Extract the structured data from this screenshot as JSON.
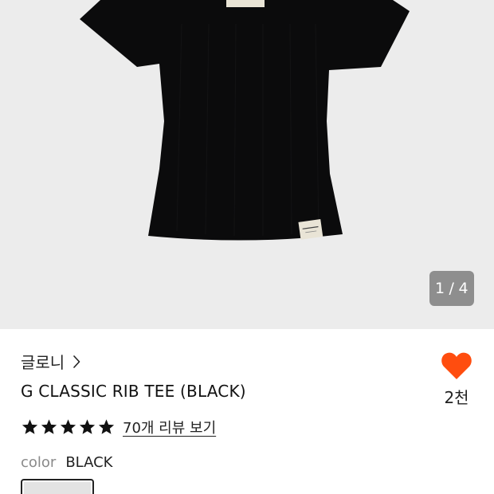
{
  "gallery": {
    "current_page": "1",
    "separator": "/",
    "total_pages": "4",
    "image_alt": "black ribbed short-sleeve t-shirt"
  },
  "product": {
    "brand": "글로니",
    "title": "G CLASSIC RIB TEE (BLACK)",
    "rating": 5,
    "review_link": "70개 리뷰 보기",
    "color_label": "color",
    "color_value": "BLACK"
  },
  "like": {
    "count": "2천",
    "color": "#ff4d0f"
  },
  "icons": {
    "brand_chevron": "chevron-right-icon",
    "like": "heart-icon",
    "star": "star-icon"
  },
  "colors": {
    "image_background": "#ececec",
    "counter_background": "#8e8e8e",
    "heart": "#ff4d0f",
    "shirt": "#0b0b0c"
  }
}
